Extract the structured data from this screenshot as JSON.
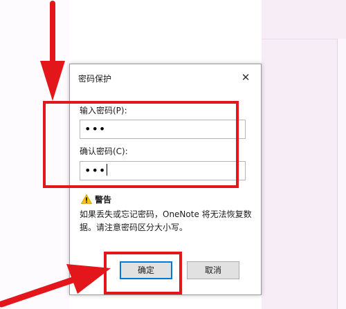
{
  "dialog": {
    "title": "密码保护",
    "close_glyph": "✕",
    "password_label": "输入密码(P):",
    "password_value": "•••",
    "confirm_label": "确认密码(C):",
    "confirm_value": "•••",
    "warning_title": "警告",
    "warning_text": "如果丢失或忘记密码，OneNote 将无法恢复数据。请注意密码区分大小写。",
    "ok_label": "确定",
    "cancel_label": "取消"
  },
  "colors": {
    "annotation": "#e3171b",
    "primary_button_border": "#0078d7",
    "warning_icon": "#f5c211"
  },
  "icons": [
    "close-icon",
    "warning-icon",
    "arrow-icon"
  ]
}
